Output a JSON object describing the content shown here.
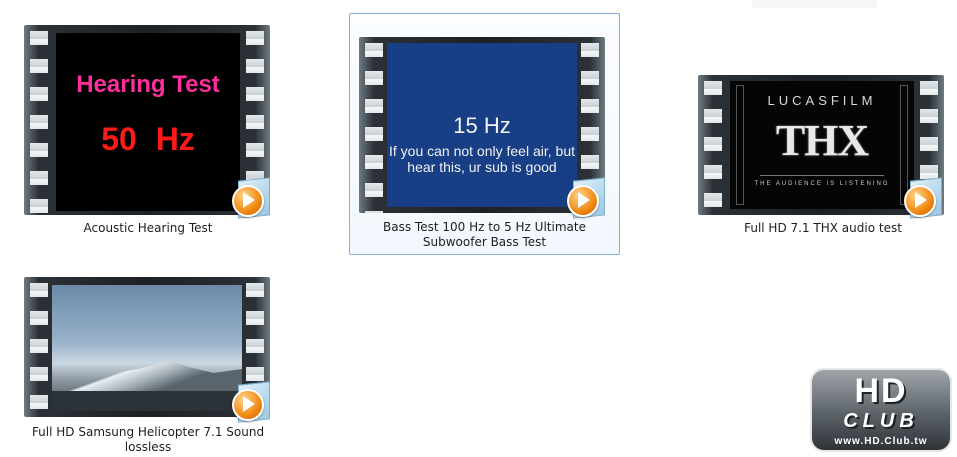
{
  "files": [
    {
      "caption": "Acoustic Hearing Test",
      "screen": {
        "line1": "Hearing Test",
        "line2": "50 Hz"
      },
      "selected": false
    },
    {
      "caption": "Bass Test 100 Hz to 5 Hz Ultimate Subwoofer Bass Test",
      "screen": {
        "line1": "15 Hz",
        "line2": "If you can not only feel air, but hear this, ur sub is good"
      },
      "selected": true
    },
    {
      "caption": "Full HD 7.1 THX audio test",
      "screen": {
        "line1": "LUCASFILM",
        "line2": "THX",
        "line3": "THE AUDIENCE IS LISTENING"
      },
      "selected": false
    },
    {
      "caption": "Full HD Samsung Helicopter 7.1 Sound lossless",
      "screen": {},
      "selected": false
    }
  ],
  "watermark": {
    "line1": "HD",
    "line2": "CLUB",
    "line3": "www.HD.Club.tw"
  },
  "icons": {
    "thumbnail_frame": "filmstrip-icon",
    "overlay": "media-player-play-icon"
  },
  "colors": {
    "selection_border": "#84acdd",
    "hearing_title": "#ff2e9e",
    "hearing_freq": "#ff1a1a",
    "bass_background": "#183f85",
    "play_orange": "#f08a12"
  }
}
